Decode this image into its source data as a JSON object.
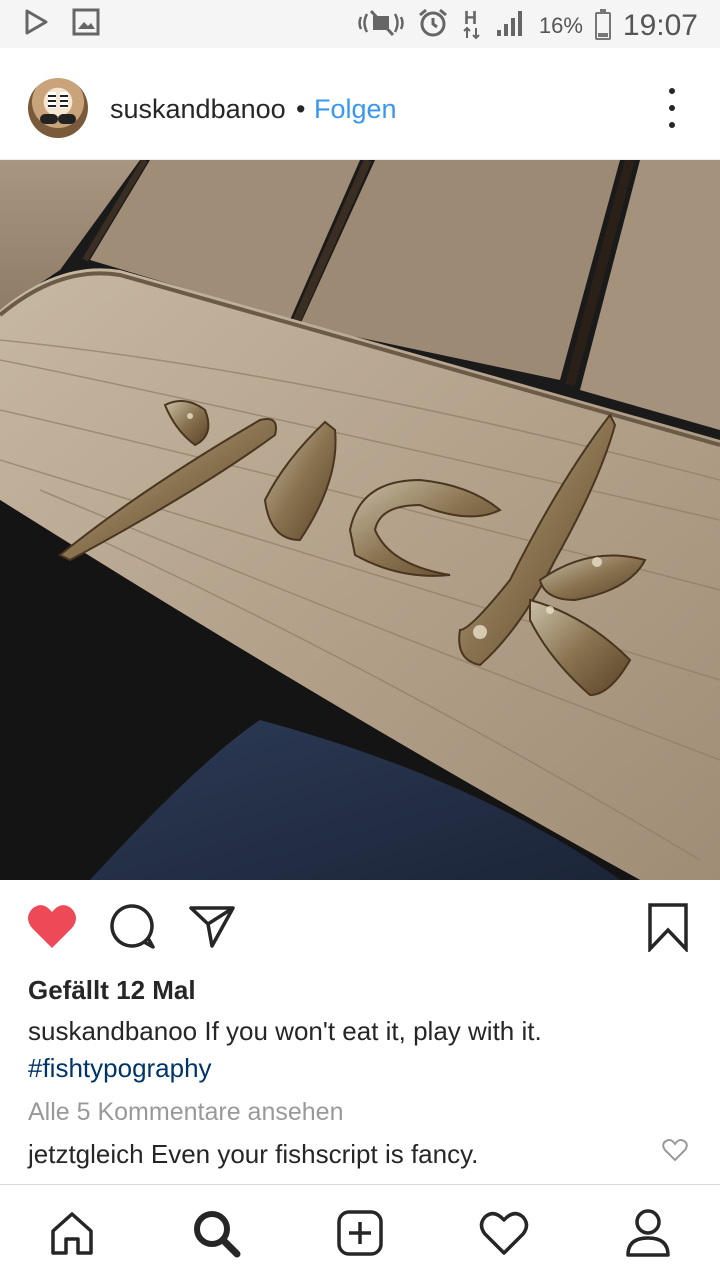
{
  "status_bar": {
    "battery_text": "16%",
    "battery_level": 0.16,
    "time": "19:07",
    "left_icons": [
      "play-store-icon",
      "image-icon"
    ],
    "right_icons": [
      "mute-icon",
      "alarm-icon",
      "network-h-icon",
      "signal-icon"
    ]
  },
  "post": {
    "username": "suskandbanoo",
    "separator": "•",
    "follow_label": "Folgen",
    "likes_text": "Gefällt 12 Mal",
    "caption_user": "suskandbanoo",
    "caption_text": " If you won't eat it, play with it.",
    "hashtag": "#fishtypography",
    "view_comments": "Alle 5 Kommentare ansehen",
    "comment_user": "jetztgleich",
    "comment_text": " Even your fishscript is fancy.",
    "liked": true
  },
  "colors": {
    "accent_blue": "#3897f0",
    "hashtag_blue": "#003569",
    "like_red": "#ed4956"
  },
  "bottom_nav": [
    "home-icon",
    "search-icon",
    "add-post-icon",
    "activity-heart-icon",
    "profile-icon"
  ]
}
